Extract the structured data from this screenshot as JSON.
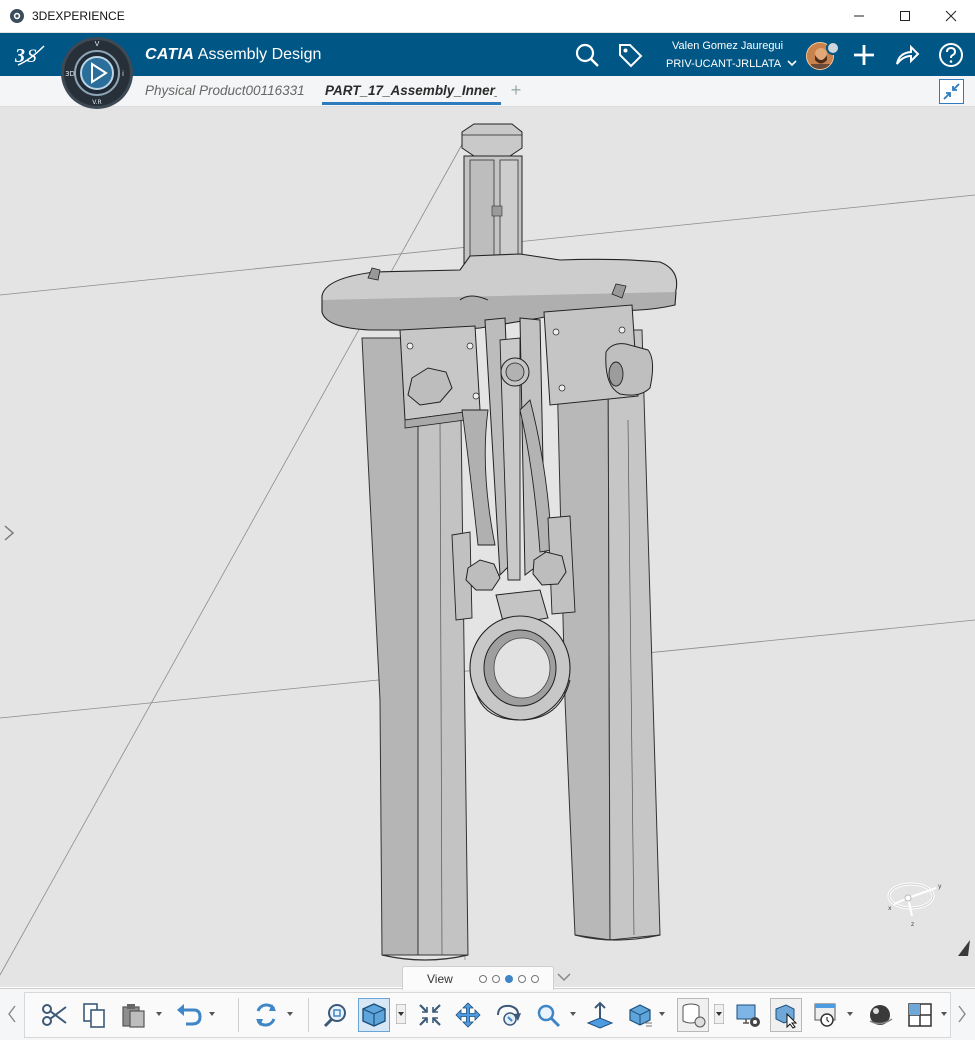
{
  "window": {
    "title": "3DEXPERIENCE",
    "controls": [
      "minimize",
      "maximize",
      "close"
    ]
  },
  "header": {
    "brand": "CATIA",
    "app": "Assembly Design",
    "compass": {
      "top": "V",
      "left": "3D",
      "right": "i",
      "bottom": "V.R"
    },
    "user_name": "Valen Gomez Jauregui",
    "tenant": "PRIV-UCANT-JRLLATA",
    "icons": [
      "search-icon",
      "tag-icon",
      "plus-icon",
      "share-icon",
      "help-icon"
    ]
  },
  "tabs": [
    {
      "label": "Physical Product00116331",
      "active": false
    },
    {
      "label": "PART_17_Assembly_Inner_",
      "active": true
    }
  ],
  "viewport": {
    "compass_axes": {
      "x": "x",
      "y": "y",
      "z": "z"
    }
  },
  "section": {
    "label": "View",
    "pages": 5,
    "active_page": 3
  },
  "actionbar": {
    "tools": [
      "cut-icon",
      "copy-icon",
      "paste-icon",
      "undo-icon",
      "update-icon",
      "fit-all-icon",
      "iso-view-icon",
      "fit-selection-icon",
      "pan-icon",
      "rotate-icon",
      "zoom-icon",
      "normal-view-icon",
      "shading-icon",
      "data-cache-icon",
      "render-settings-icon",
      "select-icon",
      "history-icon",
      "sphere-icon",
      "layout-icon"
    ]
  },
  "colors": {
    "header": "#005685",
    "accent": "#2f7bbd",
    "viewport": "#e4e4e4",
    "part": "#b9b9b9"
  }
}
